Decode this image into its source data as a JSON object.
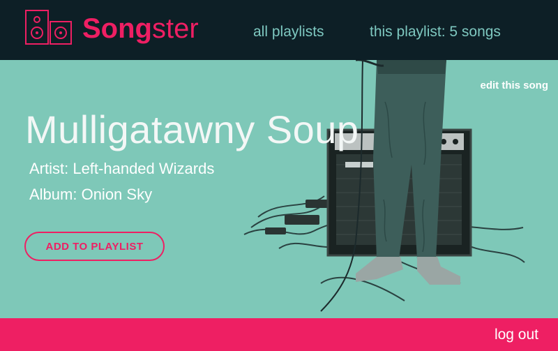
{
  "header": {
    "brand_bold": "Song",
    "brand_rest": "ster",
    "nav": {
      "all_playlists": "all playlists",
      "this_playlist": "this playlist:  5 songs"
    }
  },
  "song": {
    "edit_label": "edit this song",
    "title": "Mulligatawny Soup",
    "artist_line": "Artist: Left-handed Wizards",
    "album_line": "Album: Onion Sky",
    "add_button": "ADD TO PLAYLIST"
  },
  "footer": {
    "logout": "log out"
  },
  "colors": {
    "header_bg": "#0d1f26",
    "accent": "#ee1f63",
    "hero_bg": "#7ec8b8",
    "nav_text": "#7ec8c0"
  },
  "icons": [
    "speaker-logo-icon"
  ]
}
